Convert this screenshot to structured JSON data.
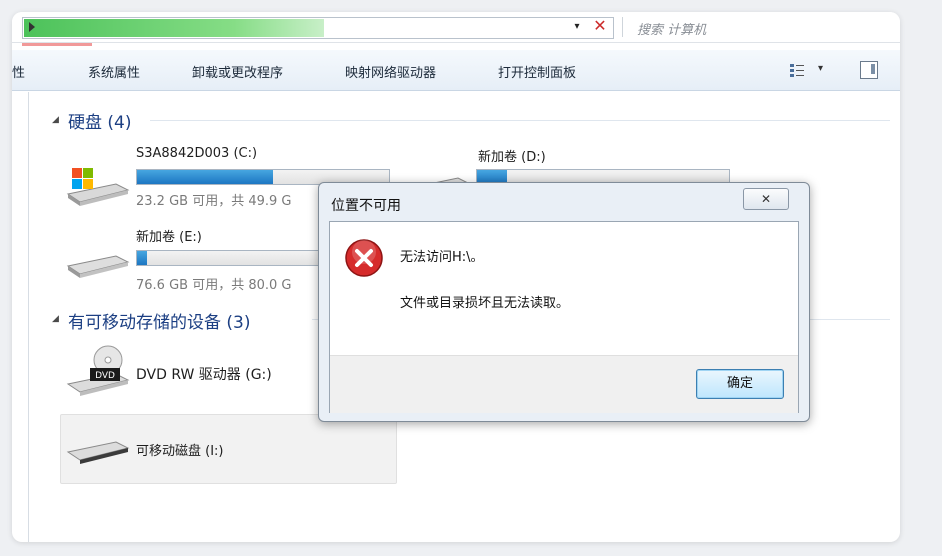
{
  "address_bar": {
    "search_placeholder": "搜索 计算机",
    "dropdown_glyph": "▾",
    "close_glyph": "✕"
  },
  "toolbar": {
    "items": [
      "性",
      "系统属性",
      "卸载或更改程序",
      "映射网络驱动器",
      "打开控制面板"
    ]
  },
  "groups": {
    "hard_drives": {
      "header": "硬盘 (4)",
      "drives": [
        {
          "name": "S3A8842D003 (C:)",
          "info": "23.2 GB 可用，共 49.9 G",
          "used_fraction": 0.54
        },
        {
          "name": "新加卷 (D:)",
          "info": "",
          "used_fraction": 0.12
        },
        {
          "name": "新加卷 (E:)",
          "info": "76.6 GB 可用，共 80.0 G",
          "used_fraction": 0.04
        }
      ]
    },
    "removable": {
      "header": "有可移动存储的设备 (3)",
      "devices": [
        {
          "name": "DVD RW 驱动器 (G:)",
          "badge": "DVD"
        },
        {
          "name": "可移动磁盘 (I:)"
        }
      ]
    }
  },
  "dialog": {
    "title": "位置不可用",
    "close_glyph": "ꜫ",
    "message": "无法访问H:\\。",
    "detail": "文件或目录损坏且无法读取。",
    "ok_label": "确定"
  },
  "colors": {
    "group_header": "#1c3f83",
    "bar_fill": "#1c76c2",
    "error_red": "#d62b2b"
  }
}
